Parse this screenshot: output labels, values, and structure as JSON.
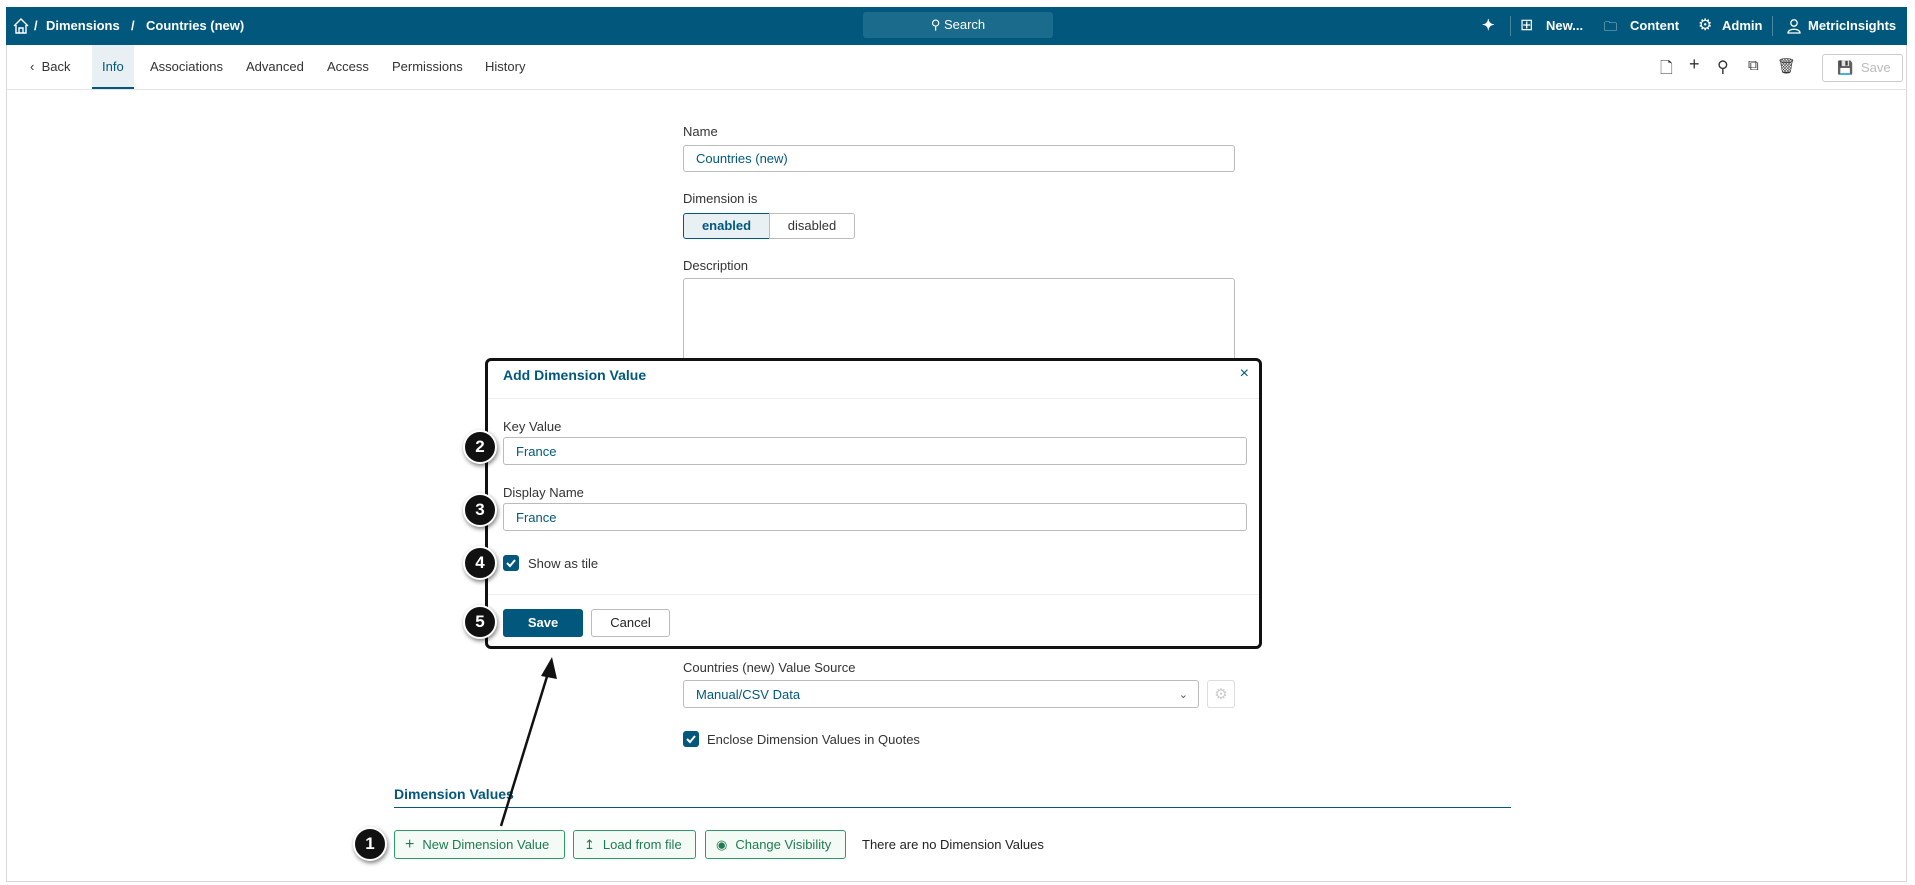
{
  "topbar": {
    "breadcrumb": [
      "Dimensions",
      "Countries (new)"
    ],
    "search": "Search",
    "new": "New...",
    "content": "Content",
    "admin": "Admin",
    "user": "MetricInsights"
  },
  "tabs": {
    "back": "Back",
    "items": [
      "Info",
      "Associations",
      "Advanced",
      "Access",
      "Permissions",
      "History"
    ],
    "active": "Info",
    "save": "Save"
  },
  "form": {
    "name_label": "Name",
    "name_value": "Countries (new)",
    "dimension_is_label": "Dimension is",
    "enabled": "enabled",
    "disabled": "disabled",
    "selected_state": "enabled",
    "description_label": "Description",
    "value_source_label": "Countries (new) Value Source",
    "value_source": "Manual/CSV Data",
    "enclose_label": "Enclose Dimension Values in Quotes",
    "enclose_checked": true
  },
  "dimension_values": {
    "heading": "Dimension Values",
    "new_button": "New Dimension Value",
    "load_button": "Load from file",
    "visibility_button": "Change Visibility",
    "empty_text": "There are no Dimension Values"
  },
  "modal": {
    "title": "Add Dimension Value",
    "key_label": "Key Value",
    "key_value": "France",
    "display_label": "Display Name",
    "display_value": "France",
    "tile_label": "Show as tile",
    "tile_checked": true,
    "save": "Save",
    "cancel": "Cancel"
  },
  "markers": [
    "1",
    "2",
    "3",
    "4",
    "5"
  ],
  "colors": {
    "brand": "#02587c",
    "green": "#1f7a52"
  }
}
